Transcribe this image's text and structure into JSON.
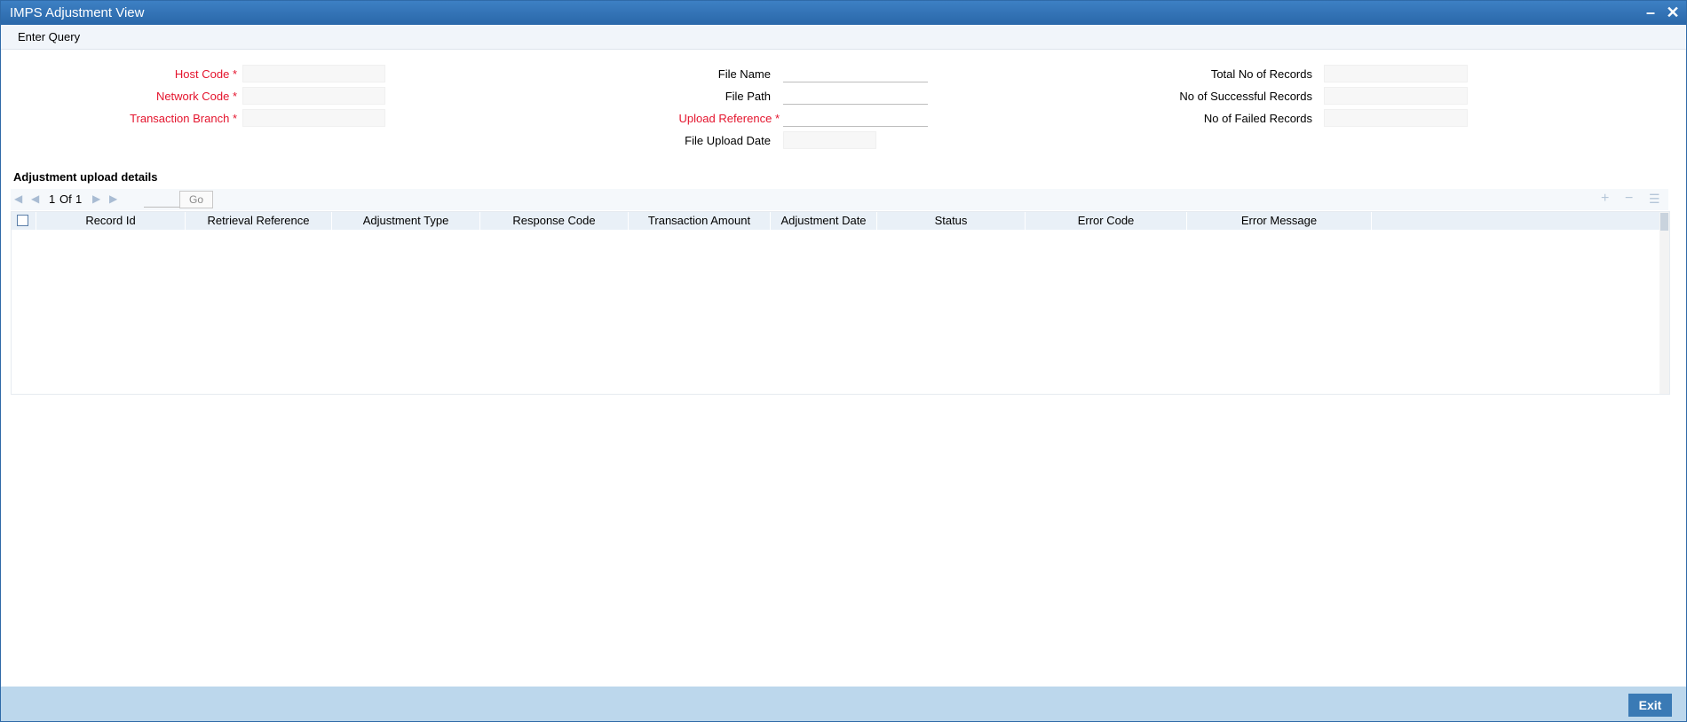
{
  "window": {
    "title": "IMPS Adjustment View",
    "minimize_glyph": "–",
    "close_glyph": "✕"
  },
  "menu": {
    "enter_query": "Enter Query"
  },
  "form": {
    "host_code": {
      "label": "Host Code",
      "value": ""
    },
    "network_code": {
      "label": "Network Code",
      "value": ""
    },
    "transaction_branch": {
      "label": "Transaction Branch",
      "value": ""
    },
    "file_name": {
      "label": "File Name",
      "value": ""
    },
    "file_path": {
      "label": "File Path",
      "value": ""
    },
    "upload_reference": {
      "label": "Upload Reference",
      "value": ""
    },
    "file_upload_date": {
      "label": "File Upload Date",
      "value": ""
    },
    "total_records": {
      "label": "Total No of Records",
      "value": ""
    },
    "successful_records": {
      "label": "No of Successful Records",
      "value": ""
    },
    "failed_records": {
      "label": "No of Failed Records",
      "value": ""
    },
    "required_marker": "*"
  },
  "section": {
    "title": "Adjustment upload details"
  },
  "pager": {
    "current": "1",
    "of_label": "Of",
    "total": "1",
    "go_label": "Go",
    "page_input": ""
  },
  "table": {
    "columns": [
      "Record Id",
      "Retrieval Reference",
      "Adjustment Type",
      "Response Code",
      "Transaction Amount",
      "Adjustment Date",
      "Status",
      "Error Code",
      "Error Message"
    ],
    "rows": []
  },
  "footer": {
    "exit_label": "Exit"
  },
  "icons": {
    "first": "first-page-icon",
    "prev": "previous-page-icon",
    "next": "next-page-icon",
    "last": "last-page-icon",
    "add": "add-row-icon",
    "remove": "delete-row-icon",
    "list": "list-view-icon"
  },
  "colors": {
    "title_bar": "#2f6aa8",
    "required_label": "#e4142d",
    "header_row": "#e9f0f7",
    "footer": "#bcd7ec",
    "exit_button": "#3a7ab5"
  }
}
